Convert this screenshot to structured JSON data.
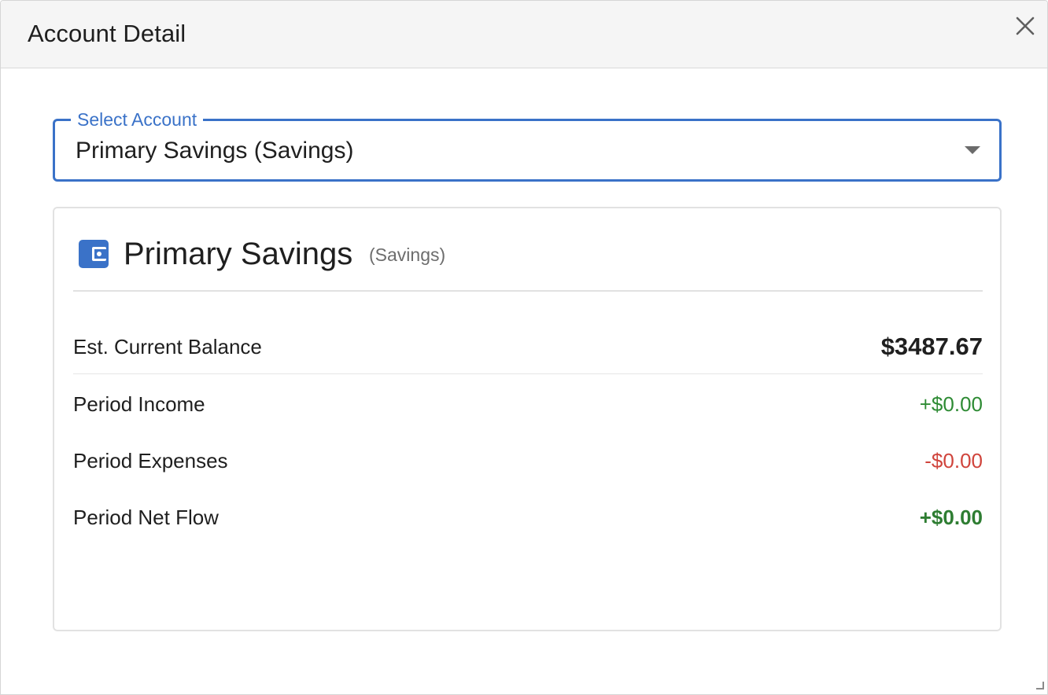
{
  "dialog": {
    "title": "Account Detail",
    "close_icon": "close-icon"
  },
  "select": {
    "label": "Select Account",
    "value": "Primary Savings (Savings)",
    "arrow_icon": "dropdown-arrow-icon"
  },
  "account": {
    "icon": "wallet-icon",
    "name": "Primary Savings",
    "type": "(Savings)"
  },
  "summary": {
    "balance": {
      "label": "Est. Current Balance",
      "value": "$3487.67"
    },
    "income": {
      "label": "Period Income",
      "value": "+$0.00",
      "color": "#2e8b34"
    },
    "expenses": {
      "label": "Period Expenses",
      "value": "-$0.00",
      "color": "#d0443c"
    },
    "net": {
      "label": "Period Net Flow",
      "value": "+$0.00",
      "color": "#2e7d32"
    }
  },
  "colors": {
    "accent": "#3a72c8",
    "positive": "#2e8b34",
    "negative": "#d0443c"
  }
}
